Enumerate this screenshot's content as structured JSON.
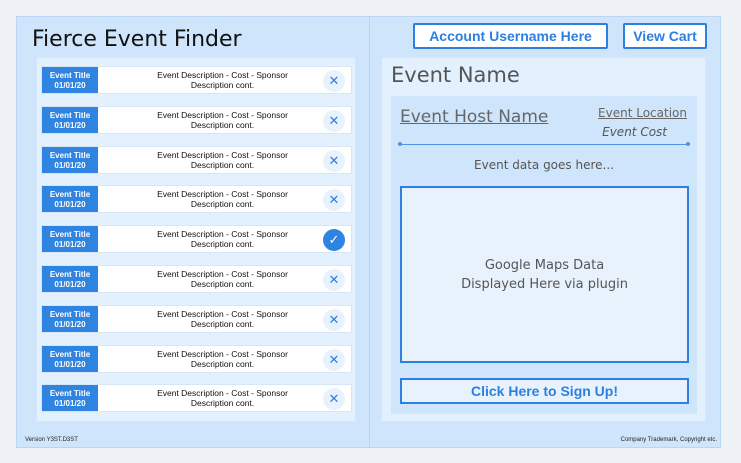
{
  "app_title": "Fierce Event Finder",
  "header": {
    "account_label": "Account Username Here",
    "cart_label": "View Cart"
  },
  "event_list": [
    {
      "title": "Event Title",
      "date": "01/01/20",
      "desc_line1": "Event Description - Cost - Sponsor",
      "desc_line2": "Description cont.",
      "action": "remove"
    },
    {
      "title": "Event Title",
      "date": "01/01/20",
      "desc_line1": "Event Description - Cost - Sponsor",
      "desc_line2": "Description cont.",
      "action": "remove"
    },
    {
      "title": "Event Title",
      "date": "01/01/20",
      "desc_line1": "Event Description - Cost - Sponsor",
      "desc_line2": "Description cont.",
      "action": "remove"
    },
    {
      "title": "Event Title",
      "date": "01/01/20",
      "desc_line1": "Event Description - Cost - Sponsor",
      "desc_line2": "Description cont.",
      "action": "remove"
    },
    {
      "title": "Event Title",
      "date": "01/01/20",
      "desc_line1": "Event Description - Cost - Sponsor",
      "desc_line2": "Description cont.",
      "action": "selected"
    },
    {
      "title": "Event Title",
      "date": "01/01/20",
      "desc_line1": "Event Description - Cost - Sponsor",
      "desc_line2": "Description cont.",
      "action": "remove"
    },
    {
      "title": "Event Title",
      "date": "01/01/20",
      "desc_line1": "Event Description - Cost - Sponsor",
      "desc_line2": "Description cont.",
      "action": "remove"
    },
    {
      "title": "Event Title",
      "date": "01/01/20",
      "desc_line1": "Event Description - Cost - Sponsor",
      "desc_line2": "Description cont.",
      "action": "remove"
    },
    {
      "title": "Event Title",
      "date": "01/01/20",
      "desc_line1": "Event Description - Cost - Sponsor",
      "desc_line2": "Description cont.",
      "action": "remove"
    }
  ],
  "icons": {
    "remove": "close-icon",
    "selected": "check-icon"
  },
  "detail": {
    "event_name": "Event Name",
    "host_name": "Event Host Name",
    "location": "Event Location",
    "cost": "Event Cost",
    "event_data": "Event data goes here...",
    "map_line1": "Google Maps Data",
    "map_line2": "Displayed Here via plugin",
    "signup_label": "Click Here to Sign Up!"
  },
  "footer": {
    "version": "Version Y3ST.D3ST",
    "trademark": "Company Trademark, Copyright etc."
  },
  "colors": {
    "accent": "#2d7fe0",
    "panel": "#cfe5fb",
    "light_panel": "#e3f0fd"
  }
}
